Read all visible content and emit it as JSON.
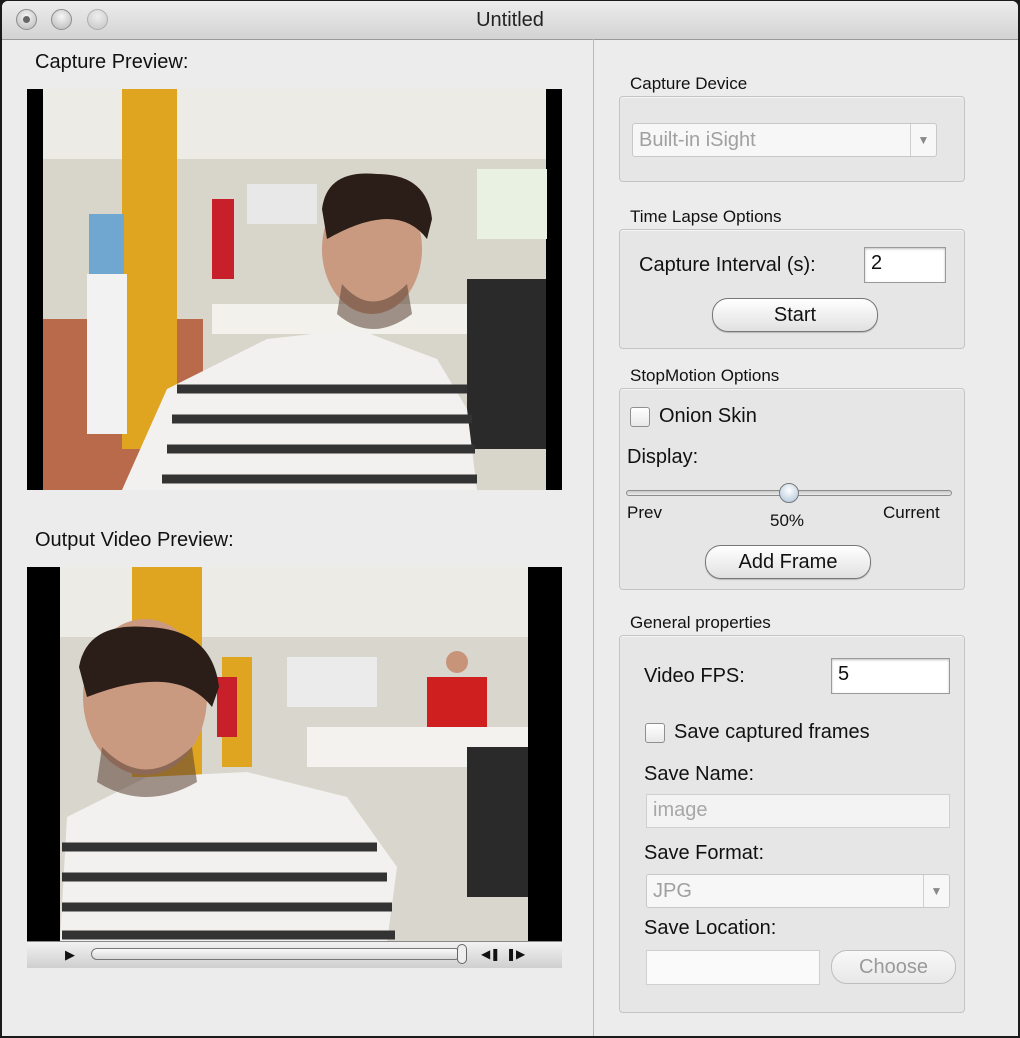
{
  "window": {
    "title": "Untitled"
  },
  "left": {
    "capture_preview_label": "Capture Preview:",
    "output_preview_label": "Output Video Preview:"
  },
  "capture_device": {
    "title": "Capture Device",
    "selected": "Built-in iSight"
  },
  "time_lapse": {
    "title": "Time Lapse Options",
    "interval_label": "Capture Interval (s):",
    "interval_value": "2",
    "start_label": "Start"
  },
  "stop_motion": {
    "title": "StopMotion Options",
    "onion_skin_label": "Onion Skin",
    "display_label": "Display:",
    "prev_label": "Prev",
    "current_label": "Current",
    "slider_value_label": "50%",
    "slider_value": 0.5,
    "add_frame_label": "Add Frame"
  },
  "general": {
    "title": "General properties",
    "fps_label": "Video FPS:",
    "fps_value": "5",
    "save_frames_label": "Save captured frames",
    "save_name_label": "Save Name:",
    "save_name_value": "image",
    "save_format_label": "Save Format:",
    "save_format_value": "JPG",
    "save_location_label": "Save Location:",
    "save_location_value": "",
    "choose_label": "Choose"
  },
  "icons": {
    "play": "play-icon",
    "step_back": "step-back-icon",
    "step_forward": "step-forward-icon"
  }
}
